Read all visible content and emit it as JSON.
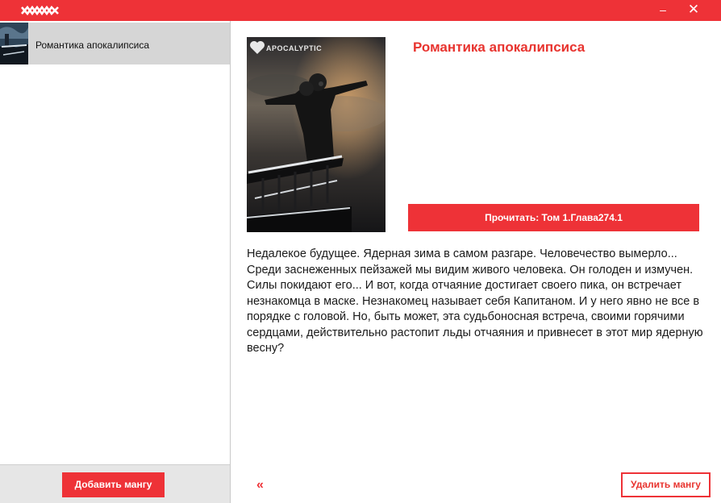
{
  "window": {
    "logo_icon": "mountain-logo-icon",
    "minimize_label": "‒",
    "close_label": "✕",
    "accent_color": "#ee3237"
  },
  "sidebar": {
    "items": [
      {
        "label": "Романтика апокалипсиса",
        "selected": true
      }
    ],
    "add_button_label": "Добавить мангу"
  },
  "main": {
    "cover_text": "APOCALYPTIC",
    "title": "Романтика апокалипсиса",
    "read_button_label": "Прочитать:  Том 1.Глава274.1",
    "description": "Недалекое будущее. Ядерная зима в самом разгаре. Человечество вымерло... Среди заснеженных пейзажей мы видим живого человека. Он голоден и измучен. Силы покидают его... И вот, когда отчаяние достигает своего пика, он встречает незнакомца в маске. Незнакомец называет себя Капитаном. И у него явно не все в порядке с головой. Но, быть может, эта судьбоносная встреча, своими горячими сердцами, действительно растопит льды отчаяния и привнесет в этот мир ядерную весну?",
    "back_label": "«",
    "delete_button_label": "Удалить мангу"
  }
}
